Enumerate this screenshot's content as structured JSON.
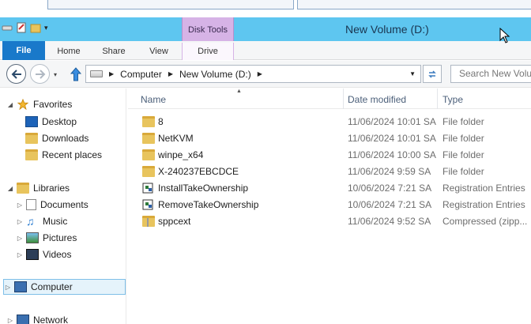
{
  "window": {
    "title": "New Volume (D:)",
    "context_tab": "Disk Tools"
  },
  "ribbon": {
    "tabs": [
      "File",
      "Home",
      "Share",
      "View",
      "Drive"
    ]
  },
  "address": {
    "breadcrumbs": [
      "Computer",
      "New Volume (D:)"
    ],
    "search_placeholder": "Search New Volume (D:)"
  },
  "nav": {
    "favorites": {
      "label": "Favorites",
      "items": [
        "Desktop",
        "Downloads",
        "Recent places"
      ]
    },
    "libraries": {
      "label": "Libraries",
      "items": [
        "Documents",
        "Music",
        "Pictures",
        "Videos"
      ]
    },
    "computer": "Computer",
    "network": "Network"
  },
  "columns": {
    "name": "Name",
    "date": "Date modified",
    "type": "Type"
  },
  "files": [
    {
      "name": "8",
      "date": "11/06/2024 10:01 SA",
      "type": "File folder",
      "icon": "folder-icon"
    },
    {
      "name": "NetKVM",
      "date": "11/06/2024 10:01 SA",
      "type": "File folder",
      "icon": "folder-icon"
    },
    {
      "name": "winpe_x64",
      "date": "11/06/2024 10:00 SA",
      "type": "File folder",
      "icon": "folder-icon"
    },
    {
      "name": "X-240237EBCDCE",
      "date": "11/06/2024 9:59 SA",
      "type": "File folder",
      "icon": "folder-icon"
    },
    {
      "name": "InstallTakeOwnership",
      "date": "10/06/2024 7:21 SA",
      "type": "Registration Entries",
      "icon": "registry-icon"
    },
    {
      "name": "RemoveTakeOwnership",
      "date": "10/06/2024 7:21 SA",
      "type": "Registration Entries",
      "icon": "registry-icon"
    },
    {
      "name": "sppcext",
      "date": "11/06/2024 9:52 SA",
      "type": "Compressed (zipp...",
      "icon": "zip-folder-icon"
    }
  ]
}
